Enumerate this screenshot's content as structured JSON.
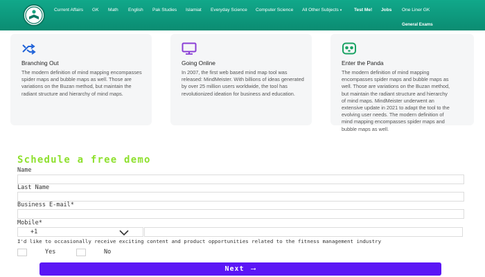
{
  "nav": {
    "items": [
      {
        "label": "Current Affairs"
      },
      {
        "label": "GK"
      },
      {
        "label": "Math"
      },
      {
        "label": "English"
      },
      {
        "label": "Pak Studies"
      },
      {
        "label": "Islamiat"
      },
      {
        "label": "Everyday Science"
      },
      {
        "label": "Computer Science"
      },
      {
        "label": "All Other Subjects"
      },
      {
        "label": "Test Me!"
      },
      {
        "label": "Jobs"
      },
      {
        "label": "One Liner GK"
      },
      {
        "label": "General Exams"
      }
    ],
    "caret": "▾"
  },
  "cards": [
    {
      "icon": "branching-arrows-icon",
      "title": "Branching Out",
      "text": "The modern definition of mind mapping encompasses spider maps and bubble maps as well. Those are variations on the Buzan method, but maintain the radiant structure and hierarchy of mind maps."
    },
    {
      "icon": "monitor-icon",
      "title": "Going Online",
      "text": "In 2007, the first web based mind map tool was released: MindMeister. With billions of ideas generated by over 25 million users worldwide, the tool has revolutionized ideation for business and education."
    },
    {
      "icon": "panda-icon",
      "title": "Enter the Panda",
      "text": "The modern definition of mind mapping encompasses spider maps and bubble maps as well. Those are variations on the Buzan method, but maintain the radiant structure and hierarchy of mind maps. MindMeister underwent an extensive update in 2021 to adapt the tool to the evolving user needs. The modern definition of mind mapping encompasses spider maps and bubble maps as well."
    }
  ],
  "form": {
    "heading": "Schedule a free demo",
    "name_label": "Name",
    "last_name_label": "Last Name",
    "email_label": "Business E-mail*",
    "mobile_label": "Mobile*",
    "country_code": "+1",
    "consent_text": "I'd like to occasionally receive exciting content and product opportunities related to the fitness management industry",
    "yes_label": "Yes",
    "no_label": "No",
    "next_label": "Next",
    "next_arrow": "⟶"
  },
  "colors": {
    "nav_bg": "#0b8c72",
    "heading": "#8ee02e",
    "button": "#5b16f5",
    "card_icon_blue": "#1f62d8",
    "card_icon_purple": "#8a3fd6",
    "card_icon_green": "#1aa364"
  }
}
